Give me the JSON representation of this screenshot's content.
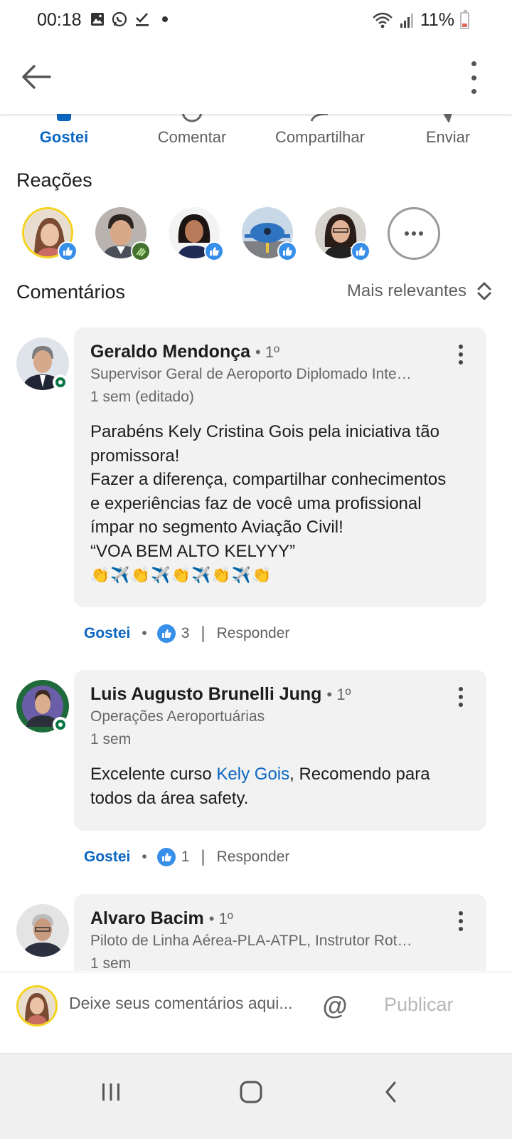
{
  "status_bar": {
    "time": "00:18",
    "battery_pct": "11%"
  },
  "actions": [
    {
      "label": "Gostei",
      "active": true
    },
    {
      "label": "Comentar",
      "active": false
    },
    {
      "label": "Compartilhar",
      "active": false
    },
    {
      "label": "Enviar",
      "active": false
    }
  ],
  "reactions": {
    "title": "Reações"
  },
  "comments": {
    "title": "Comentários",
    "sort_label": "Mais relevantes",
    "items": [
      {
        "name": "Geraldo Mendonça",
        "degree": "• 1º",
        "headline": "Supervisor Geral de Aeroporto Diplomado Inte…",
        "time": "1 sem (editado)",
        "body_lines": [
          "Parabéns Kely Cristina Gois pela iniciativa tão",
          "promissora!",
          "Fazer a diferença, compartilhar conhecimentos",
          "e experiências faz de você uma profissional",
          "ímpar no segmento Aviação Civil!",
          "“VOA BEM ALTO KELYYY”",
          "👏✈️👏✈️👏✈️👏✈️👏"
        ],
        "like_label": "Gostei",
        "like_count": "3",
        "reply_label": "Responder"
      },
      {
        "name": "Luis Augusto Brunelli Jung",
        "degree": "• 1º",
        "headline": "Operações Aeroportuárias",
        "time": "1 sem",
        "body_prefix": "Excelente curso ",
        "body_mention": "Kely Gois",
        "body_suffix": ", Recomendo para todos da área safety.",
        "like_label": "Gostei",
        "like_count": "1",
        "reply_label": "Responder"
      },
      {
        "name": "Alvaro Bacim",
        "degree": "• 1º",
        "headline": "Piloto de Linha Aérea-PLA-ATPL, Instrutor Rot…",
        "time": "1 sem"
      }
    ]
  },
  "composer": {
    "placeholder": "Deixe seus comentários aqui...",
    "at_symbol": "@",
    "publish_label": "Publicar"
  }
}
